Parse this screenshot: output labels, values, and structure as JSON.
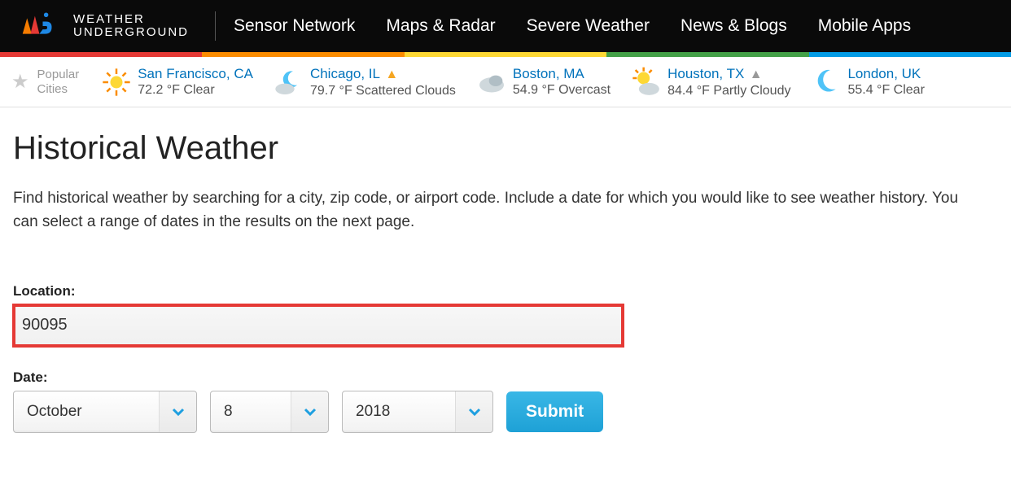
{
  "brand": {
    "line1": "WEATHER",
    "line2": "UNDERGROUND"
  },
  "nav": {
    "links": [
      "Sensor Network",
      "Maps & Radar",
      "Severe Weather",
      "News & Blogs",
      "Mobile Apps"
    ]
  },
  "popular": {
    "label_line1": "Popular",
    "label_line2": "Cities",
    "cities": [
      {
        "name": "San Francisco, CA",
        "cond": "72.2 °F Clear",
        "icon": "sun",
        "warn": false
      },
      {
        "name": "Chicago, IL",
        "cond": "79.7 °F Scattered Clouds",
        "icon": "partly",
        "warn": true
      },
      {
        "name": "Boston, MA",
        "cond": "54.9 °F Overcast",
        "icon": "cloud",
        "warn": false
      },
      {
        "name": "Houston, TX",
        "cond": "84.4 °F Partly Cloudy",
        "icon": "sun",
        "warn": true
      },
      {
        "name": "London, UK",
        "cond": "55.4 °F Clear",
        "icon": "moon",
        "warn": false
      }
    ]
  },
  "page": {
    "title": "Historical Weather",
    "intro": "Find historical weather by searching for a city, zip code, or airport code. Include a date for which you would like to see weather history. You can select a range of dates in the results on the next page."
  },
  "form": {
    "location_label": "Location:",
    "location_value": "90095",
    "date_label": "Date:",
    "month": "October",
    "day": "8",
    "year": "2018",
    "submit": "Submit"
  }
}
